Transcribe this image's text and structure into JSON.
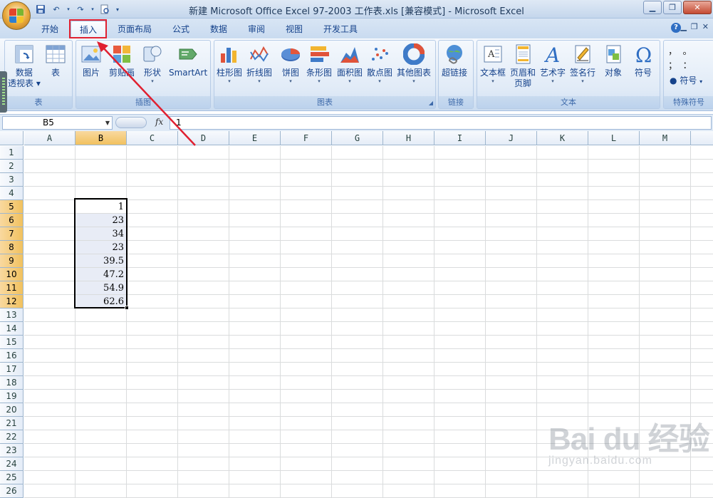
{
  "window": {
    "title": "新建 Microsoft Office Excel 97-2003 工作表.xls  [兼容模式] - Microsoft Excel"
  },
  "tabs": [
    "开始",
    "插入",
    "页面布局",
    "公式",
    "数据",
    "审阅",
    "视图",
    "开发工具"
  ],
  "active_tab": "插入",
  "ribbon": {
    "groups": {
      "table": "表",
      "illustrations": "插图",
      "charts": "图表",
      "links": "链接",
      "text": "文本",
      "symbols": "特殊符号"
    },
    "buttons": {
      "pivot_line1": "数据",
      "pivot_line2": "透视表",
      "table": "表",
      "picture": "图片",
      "clipart": "剪贴画",
      "shapes": "形状",
      "smartart": "SmartArt",
      "column": "柱形图",
      "line": "折线图",
      "pie": "饼图",
      "bar": "条形图",
      "area": "面积图",
      "scatter": "散点图",
      "other_charts": "其他图表",
      "hyperlink": "超链接",
      "textbox": "文本框",
      "header_line1": "页眉和",
      "header_line2": "页脚",
      "wordart": "艺术字",
      "signature": "签名行",
      "object": "对象",
      "symbol": "符号",
      "special_symbol": "符号"
    }
  },
  "formula_bar": {
    "name_box": "B5",
    "fx": "fx",
    "value": "1"
  },
  "columns": [
    "A",
    "B",
    "C",
    "D",
    "E",
    "F",
    "G",
    "H",
    "I",
    "J",
    "K",
    "L",
    "M"
  ],
  "selected_column": "B",
  "rows": [
    "1",
    "2",
    "3",
    "4",
    "5",
    "6",
    "7",
    "8",
    "9",
    "10",
    "11",
    "12",
    "13",
    "14",
    "15",
    "16",
    "17",
    "18",
    "19",
    "20",
    "21",
    "22",
    "23",
    "24",
    "25",
    "26"
  ],
  "selected_rows": [
    "5",
    "6",
    "7",
    "8",
    "9",
    "10",
    "11",
    "12"
  ],
  "cells": {
    "B5": "1",
    "B6": "23",
    "B7": "34",
    "B8": "23",
    "B9": "39.5",
    "B10": "47.2",
    "B11": "54.9",
    "B12": "62.6"
  },
  "watermark": {
    "line1": "Bai du 经验",
    "line2": "jingyan.baidu.com"
  },
  "colors": {
    "highlight_box": "#e02030",
    "annotation_arrow": "#e02030",
    "selected_header": "#f1c15f"
  }
}
